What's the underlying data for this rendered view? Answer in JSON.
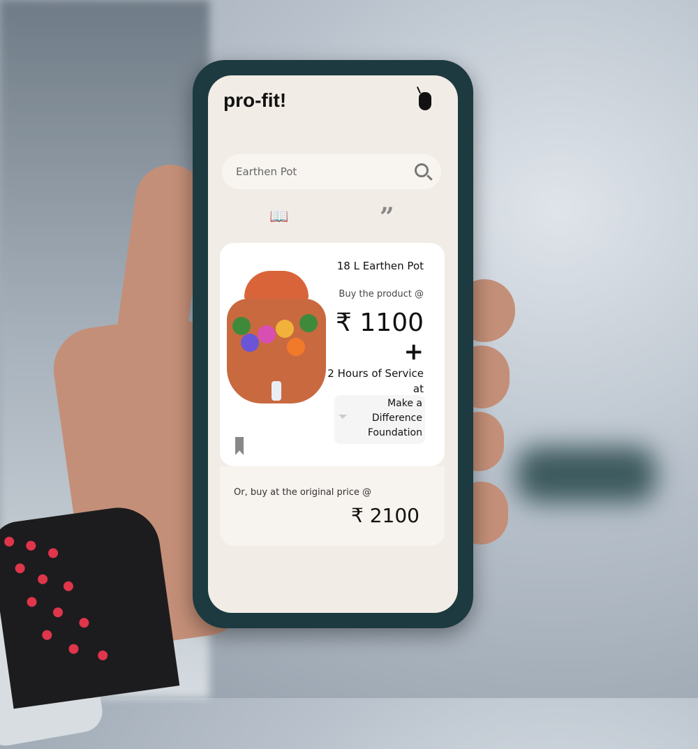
{
  "app": {
    "logo": "pro-fit!"
  },
  "search": {
    "value": "Earthen Pot"
  },
  "tabs": {
    "book_icon": "book-open-icon",
    "quote_icon": "quote-icon",
    "quote_glyph": "”"
  },
  "product": {
    "title": "18 L Earthen Pot",
    "buy_label": "Buy the product @",
    "price": "₹ 1100",
    "plus": "+",
    "service": "2 Hours of Service at",
    "organization": "Make a Difference Foundation"
  },
  "original": {
    "label": "Or, buy at the original price @",
    "price": "₹ 2100"
  },
  "colors": {
    "screen": "#f1ece5",
    "frame": "#1c3a40",
    "pot": "#c9693f"
  }
}
